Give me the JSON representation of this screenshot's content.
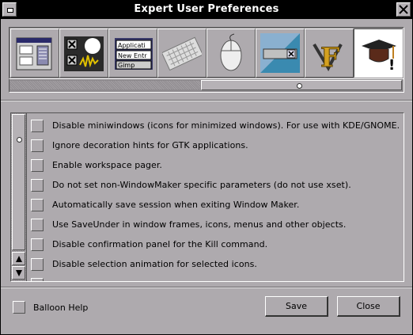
{
  "window": {
    "title": "Expert User Preferences"
  },
  "icons": [
    {
      "name": "window-handling-icon"
    },
    {
      "name": "window-focus-icon"
    },
    {
      "name": "menu-preferences-icon",
      "text_lines": [
        "Applicati",
        "New Entr",
        "Gimp"
      ]
    },
    {
      "name": "keyboard-shortcuts-icon"
    },
    {
      "name": "mouse-preferences-icon"
    },
    {
      "name": "appearance-icon"
    },
    {
      "name": "font-configuration-icon",
      "glyph": "F"
    },
    {
      "name": "expert-user-icon",
      "glyph": "!",
      "selected": true
    }
  ],
  "options": [
    {
      "label": "Disable miniwindows (icons for minimized windows). For use with KDE/GNOME.",
      "checked": false
    },
    {
      "label": "Ignore decoration hints for GTK applications.",
      "checked": false
    },
    {
      "label": "Enable workspace pager.",
      "checked": false
    },
    {
      "label": "Do not set non-WindowMaker specific parameters (do not use xset).",
      "checked": false
    },
    {
      "label": "Automatically save session when exiting Window Maker.",
      "checked": false
    },
    {
      "label": "Use SaveUnder in window frames, icons, menus and other objects.",
      "checked": false
    },
    {
      "label": "Disable confirmation panel for the Kill command.",
      "checked": false
    },
    {
      "label": "Disable selection animation for selected icons.",
      "checked": false
    }
  ],
  "footer": {
    "balloon_help_label": "Balloon Help",
    "balloon_help_checked": false,
    "save_label": "Save",
    "close_label": "Close"
  }
}
